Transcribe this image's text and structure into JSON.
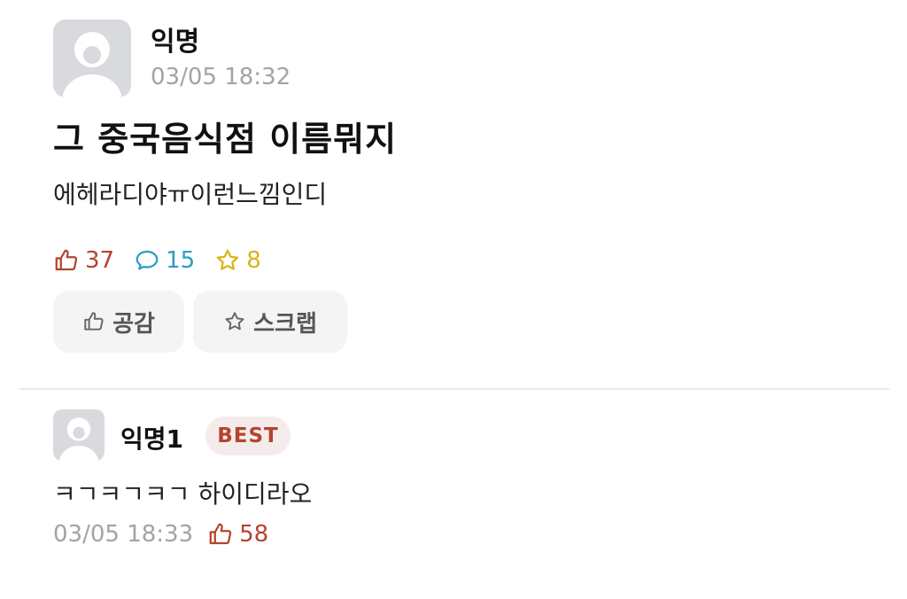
{
  "post": {
    "author": "익명",
    "time": "03/05 18:32",
    "title": "그 중국음식점 이름뭐지",
    "body": "에헤라디야ㅠ이런느낌인디",
    "stats": {
      "likes": "37",
      "comments": "15",
      "scraps": "8"
    },
    "buttons": {
      "like_label": "공감",
      "scrap_label": "스크랩"
    }
  },
  "comment": {
    "author": "익명1",
    "badge": "BEST",
    "text": "ㅋㄱㅋㄱㅋㄱ 하이디라오",
    "time": "03/05 18:33",
    "likes": "58"
  },
  "colors": {
    "like": "#b5432e",
    "comment": "#2c9ec0",
    "scrap": "#d9b51a",
    "muted": "#a3a3a3",
    "button_bg": "#f4f4f4",
    "badge_bg": "#f4ecea"
  },
  "icons": {
    "avatar": "default-profile-icon",
    "like": "thumbs-up-icon",
    "comment": "speech-bubble-icon",
    "scrap": "star-icon"
  }
}
